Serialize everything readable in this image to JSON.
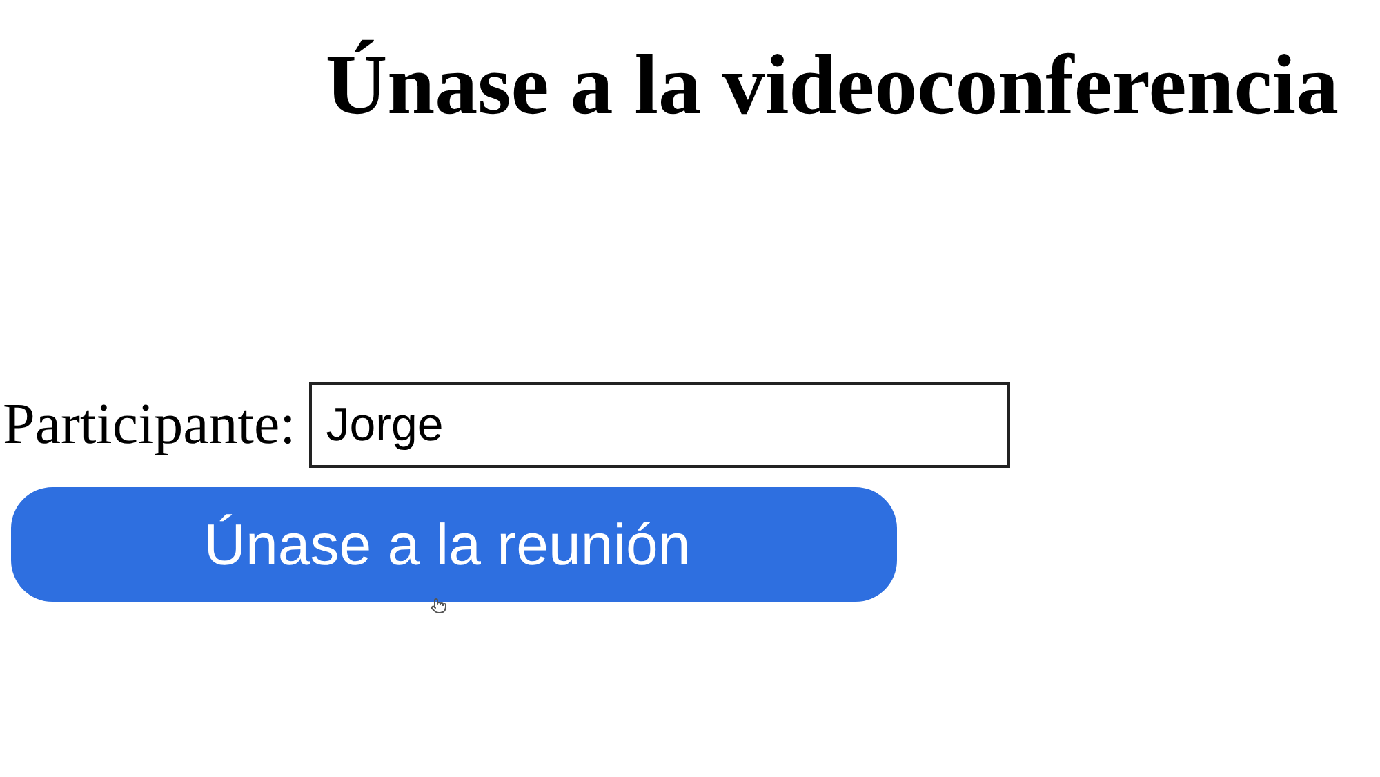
{
  "title": "Únase a la videoconferencia",
  "participant": {
    "label": "Participante:",
    "value": "Jorge"
  },
  "join_button": {
    "label": "Únase a la reunión"
  }
}
